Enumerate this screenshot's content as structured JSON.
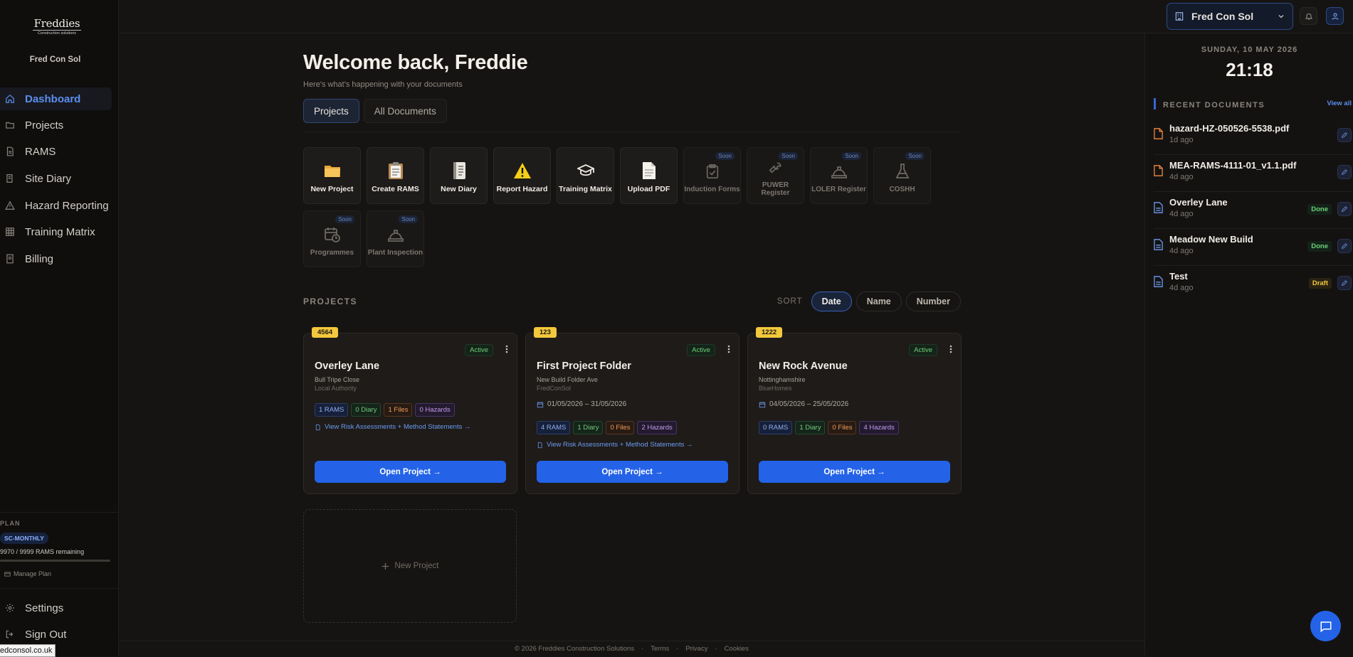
{
  "sidebar": {
    "logo_line1": "Freddies",
    "logo_line2": "Construction solutions",
    "org_name": "Fred Con Sol",
    "items": [
      {
        "label": "Dashboard",
        "icon": "home-icon"
      },
      {
        "label": "Projects",
        "icon": "folder-icon"
      },
      {
        "label": "RAMS",
        "icon": "document-icon"
      },
      {
        "label": "Site Diary",
        "icon": "book-icon"
      },
      {
        "label": "Hazard Reporting",
        "icon": "warning-icon"
      },
      {
        "label": "Training Matrix",
        "icon": "grid-icon"
      },
      {
        "label": "Billing",
        "icon": "receipt-icon"
      }
    ],
    "plan": {
      "label": "PLAN",
      "badge": "SC-MONTHLY",
      "remaining": "9970 / 9999 RAMS remaining",
      "remaining_fraction": 0.997,
      "manage": "Manage Plan"
    },
    "bottom": [
      {
        "label": "Settings",
        "icon": "gear-icon"
      },
      {
        "label": "Sign Out",
        "icon": "sign-out-icon"
      }
    ],
    "status_url": "edconsol.co.uk"
  },
  "topbar": {
    "org_switch": "Fred Con Sol"
  },
  "main": {
    "title": "Welcome back, Freddie",
    "subtitle": "Here's what's happening with your documents",
    "tabs": [
      {
        "label": "Projects",
        "active": true
      },
      {
        "label": "All Documents",
        "active": false
      }
    ],
    "quick_actions": [
      {
        "label": "New Project",
        "icon": "folder-icon",
        "soon": false
      },
      {
        "label": "Create RAMS",
        "icon": "clipboard-icon",
        "soon": false
      },
      {
        "label": "New Diary",
        "icon": "notebook-icon",
        "soon": false
      },
      {
        "label": "Report Hazard",
        "icon": "warning-icon",
        "soon": false
      },
      {
        "label": "Training Matrix",
        "icon": "graduation-cap-icon",
        "soon": false
      },
      {
        "label": "Upload PDF",
        "icon": "page-icon",
        "soon": false
      },
      {
        "label": "Induction Forms",
        "icon": "clipboard-check-icon",
        "soon": true
      },
      {
        "label": "PUWER Register",
        "icon": "wrench-icon",
        "soon": true
      },
      {
        "label": "LOLER Register",
        "icon": "hard-hat-icon",
        "soon": true
      },
      {
        "label": "COSHH",
        "icon": "flask-icon",
        "soon": true
      },
      {
        "label": "Programmes",
        "icon": "calendar-clock-icon",
        "soon": true
      },
      {
        "label": "Plant Inspection",
        "icon": "hard-hat-icon",
        "soon": true
      }
    ],
    "soon_label": "Soon",
    "projects_title": "PROJECTS",
    "sort_label": "SORT",
    "sort_options": [
      "Date",
      "Name",
      "Number"
    ],
    "sort_active": "Date",
    "projects": [
      {
        "number": "4564",
        "status": "Active",
        "name": "Overley Lane",
        "address": "Bull Tripe Close",
        "client": "Local Authority",
        "dates": "",
        "chips": {
          "rams": "1 RAMS",
          "diary": "0 Diary",
          "files": "1 Files",
          "hazards": "0 Hazards"
        },
        "link": "View Risk Assessments + Method Statements →",
        "open": "Open Project →"
      },
      {
        "number": "123",
        "status": "Active",
        "name": "First Project Folder",
        "address": "New Build Folder Ave",
        "client": "FredConSol",
        "dates": "01/05/2026 – 31/05/2026",
        "chips": {
          "rams": "4 RAMS",
          "diary": "1 Diary",
          "files": "0 Files",
          "hazards": "2 Hazards"
        },
        "link": "View Risk Assessments + Method Statements →",
        "open": "Open Project →"
      },
      {
        "number": "1222",
        "status": "Active",
        "name": "New Rock Avenue",
        "address": "Nottinghamshire",
        "client": "BlueHomes",
        "dates": "04/05/2026 – 25/05/2026",
        "chips": {
          "rams": "0 RAMS",
          "diary": "1 Diary",
          "files": "0 Files",
          "hazards": "4 Hazards"
        },
        "link": "",
        "open": "Open Project →"
      }
    ],
    "new_project": "New Project"
  },
  "right_panel": {
    "date": "SUNDAY, 10 MAY 2026",
    "time": "21:18",
    "recent_title": "RECENT DOCUMENTS",
    "view_all": "View all",
    "documents": [
      {
        "name": "hazard-HZ-050526-5538.pdf",
        "time": "1d ago",
        "status": "",
        "kind": "pdf"
      },
      {
        "name": "MEA-RAMS-4111-01_v1.1.pdf",
        "time": "4d ago",
        "status": "",
        "kind": "pdf"
      },
      {
        "name": "Overley Lane",
        "time": "4d ago",
        "status": "Done",
        "kind": "doc"
      },
      {
        "name": "Meadow New Build",
        "time": "4d ago",
        "status": "Done",
        "kind": "doc"
      },
      {
        "name": "Test",
        "time": "4d ago",
        "status": "Draft",
        "kind": "doc"
      }
    ]
  },
  "footer": {
    "copyright": "© 2026 Freddies Construction Solutions",
    "links": [
      "Terms",
      "Privacy",
      "Cookies"
    ]
  },
  "colors": {
    "accent": "#2463e8",
    "project_number": "#f3c83c",
    "active_status": "#6fcf78"
  }
}
